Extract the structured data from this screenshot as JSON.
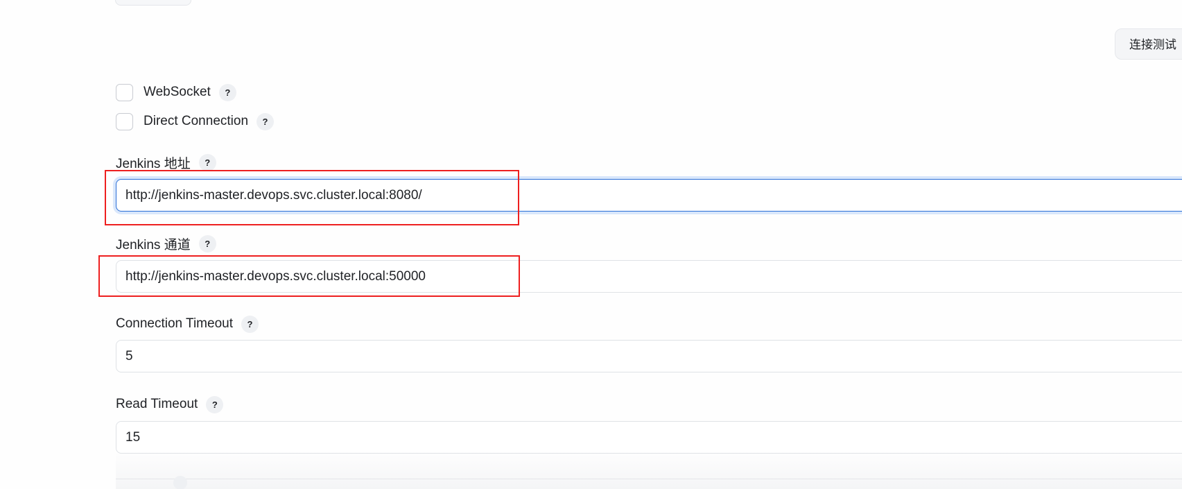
{
  "toolbar": {
    "test_connection_label": "连接测试"
  },
  "options": {
    "websocket": {
      "label": "WebSocket",
      "checked": false,
      "help": "?"
    },
    "direct_connection": {
      "label": "Direct Connection",
      "checked": false,
      "help": "?"
    }
  },
  "fields": {
    "jenkins_url": {
      "label": "Jenkins 地址",
      "help": "?",
      "value": "http://jenkins-master.devops.svc.cluster.local:8080/"
    },
    "jenkins_tunnel": {
      "label": "Jenkins 通道",
      "help": "?",
      "value": "http://jenkins-master.devops.svc.cluster.local:50000"
    },
    "connection_timeout": {
      "label": "Connection Timeout",
      "help": "?",
      "value": "5"
    },
    "read_timeout": {
      "label": "Read Timeout",
      "help": "?",
      "value": "15"
    }
  },
  "colors": {
    "highlight": "#ee1f1f",
    "focus": "#2b6fd6"
  },
  "icons": {
    "help": "question-circle-icon"
  }
}
